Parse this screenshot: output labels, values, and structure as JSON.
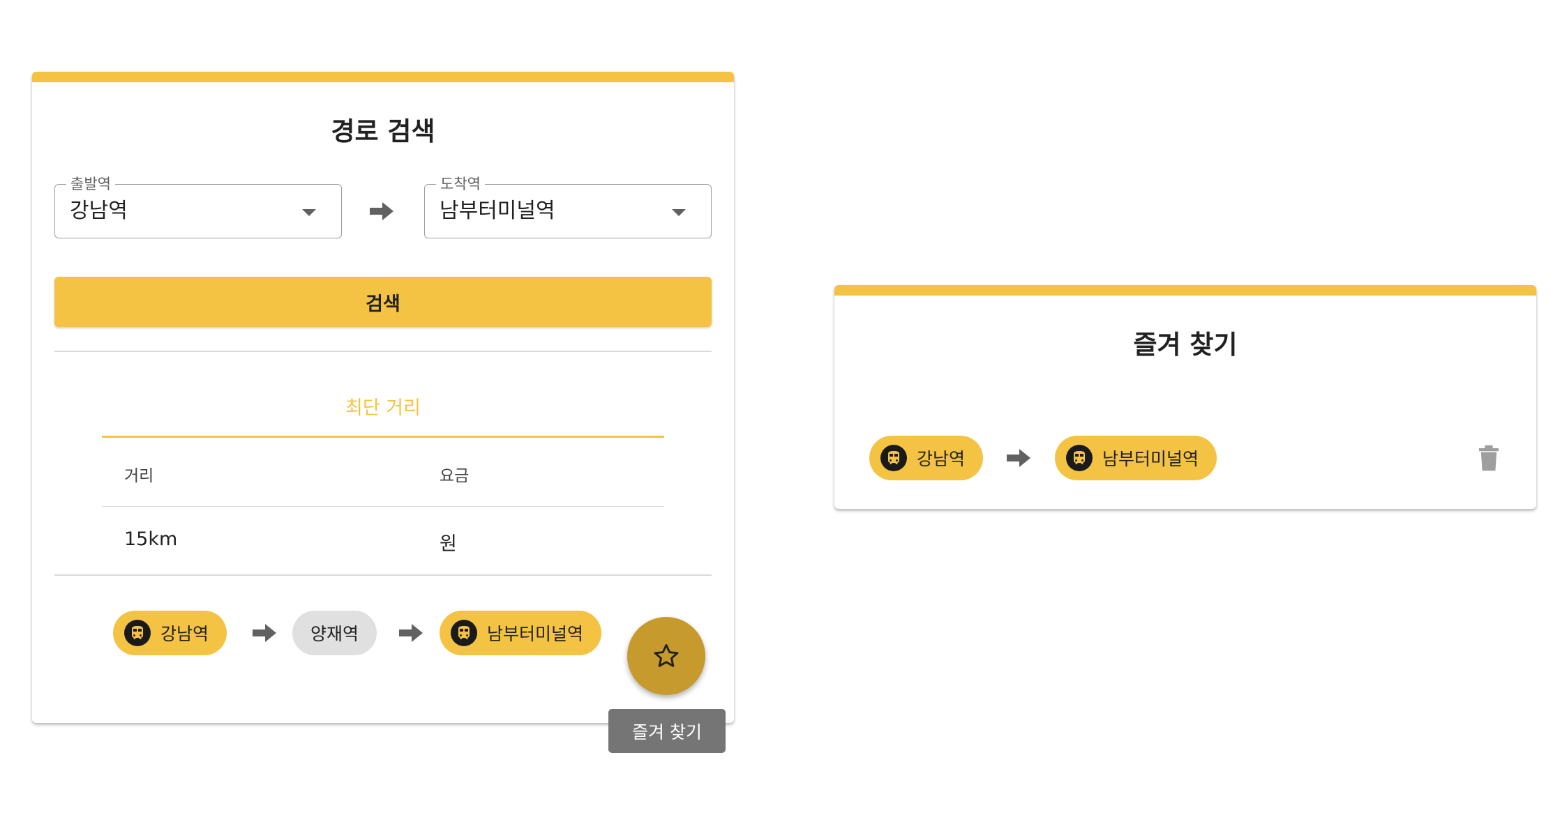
{
  "search": {
    "title": "경로 검색",
    "departure": {
      "label": "출발역",
      "value": "강남역"
    },
    "arrival": {
      "label": "도착역",
      "value": "남부터미널역"
    },
    "search_button": "검색",
    "tab": "최단 거리",
    "table": {
      "headers": [
        "거리",
        "요금"
      ],
      "row": [
        "15km",
        "원"
      ]
    },
    "path": [
      "강남역",
      "양재역",
      "남부터미널역"
    ],
    "fab_tooltip": "즐겨 찾기"
  },
  "favorites": {
    "title": "즐겨 찾기",
    "items": [
      {
        "from": "강남역",
        "to": "남부터미널역"
      }
    ]
  },
  "colors": {
    "accent": "#f5c343",
    "fab": "#c79a2e",
    "tooltip": "#757575",
    "chip_grey": "#e0e0e0"
  },
  "icons": [
    "chevron-down-icon",
    "arrow-right-icon",
    "subway-icon",
    "star-outline-icon",
    "trash-icon"
  ]
}
